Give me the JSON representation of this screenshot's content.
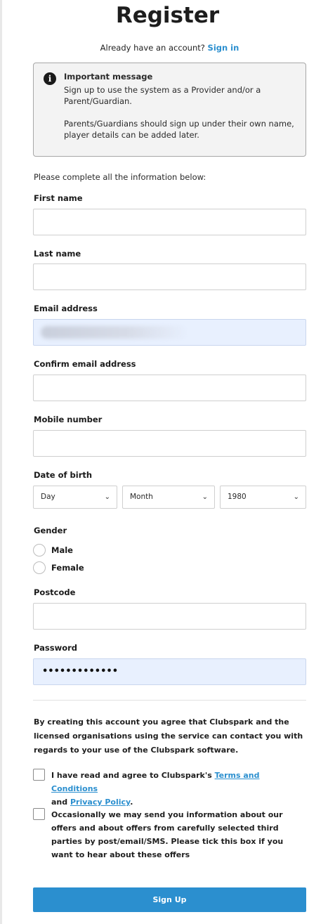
{
  "page": {
    "title": "Register"
  },
  "signin": {
    "prompt": "Already have an account?",
    "link": "Sign in"
  },
  "notice": {
    "icon": "info-icon",
    "title": "Important message",
    "line1": "Sign up to use the system as a Provider and/or a Parent/Guardian.",
    "line2": "Parents/Guardians should sign up under their own name, player details can be added later."
  },
  "form": {
    "intro": "Please complete all the information below:",
    "first_name": {
      "label": "First name",
      "value": ""
    },
    "last_name": {
      "label": "Last name",
      "value": ""
    },
    "email": {
      "label": "Email address",
      "value": ""
    },
    "confirm_email": {
      "label": "Confirm email address",
      "value": ""
    },
    "mobile": {
      "label": "Mobile number",
      "value": ""
    },
    "dob": {
      "label": "Date of birth",
      "day": "Day",
      "month": "Month",
      "year": "1980"
    },
    "gender": {
      "label": "Gender",
      "options": [
        "Male",
        "Female"
      ]
    },
    "postcode": {
      "label": "Postcode",
      "value": ""
    },
    "password": {
      "label": "Password",
      "masked": "•••••••••••••"
    }
  },
  "consent": {
    "statement": "By creating this account you agree that Clubspark and the licensed organisations using the service can contact you with regards to your use of the Clubspark software.",
    "terms_prefix": "I have read and agree to Clubspark's ",
    "terms_link": "Terms and Conditions",
    "terms_and": "and ",
    "privacy_link": "Privacy Policy",
    "terms_suffix": ".",
    "offers": "Occasionally we may send you information about our offers and about offers from carefully selected third parties by post/email/SMS. Please tick this box if you want to hear about these offers"
  },
  "actions": {
    "signup": "Sign Up"
  },
  "colors": {
    "accent": "#2b8fcf",
    "autofill": "#e8f0fe"
  }
}
